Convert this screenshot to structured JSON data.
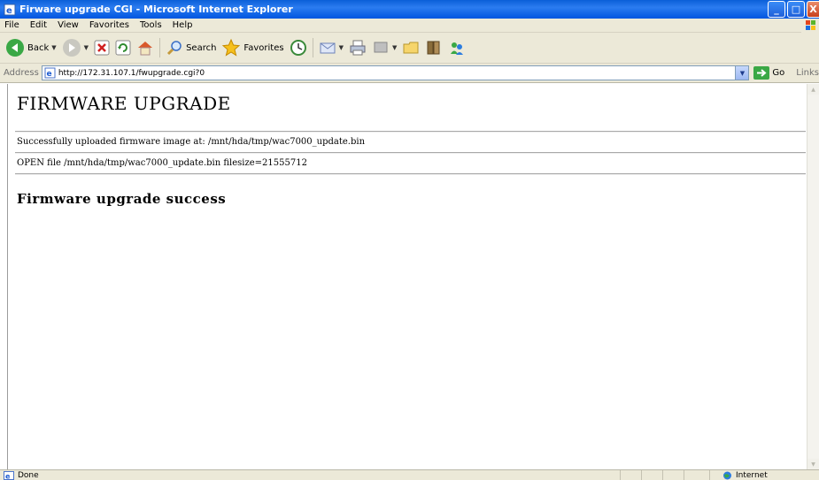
{
  "window": {
    "title": "Firware upgrade CGI - Microsoft Internet Explorer",
    "minimize_label": "_",
    "maximize_label": "□",
    "close_label": "X"
  },
  "menu": {
    "items": [
      "File",
      "Edit",
      "View",
      "Favorites",
      "Tools",
      "Help"
    ]
  },
  "toolbar": {
    "back_label": "Back",
    "search_label": "Search",
    "favorites_label": "Favorites"
  },
  "address": {
    "label": "Address",
    "url": "http://172.31.107.1/fwupgrade.cgi?0",
    "go_label": "Go",
    "links_label": "Links"
  },
  "page": {
    "heading": "FIRMWARE UPGRADE",
    "upload_message": "Successfully uploaded firmware image at: /mnt/hda/tmp/wac7000_update.bin",
    "open_message": "OPEN file /mnt/hda/tmp/wac7000_update.bin filesize=21555712",
    "result": "Firmware upgrade success"
  },
  "status": {
    "text": "Done",
    "zone": "Internet"
  },
  "colors": {
    "titlebar": "#0a5fd8",
    "chrome": "#ece9d8"
  }
}
